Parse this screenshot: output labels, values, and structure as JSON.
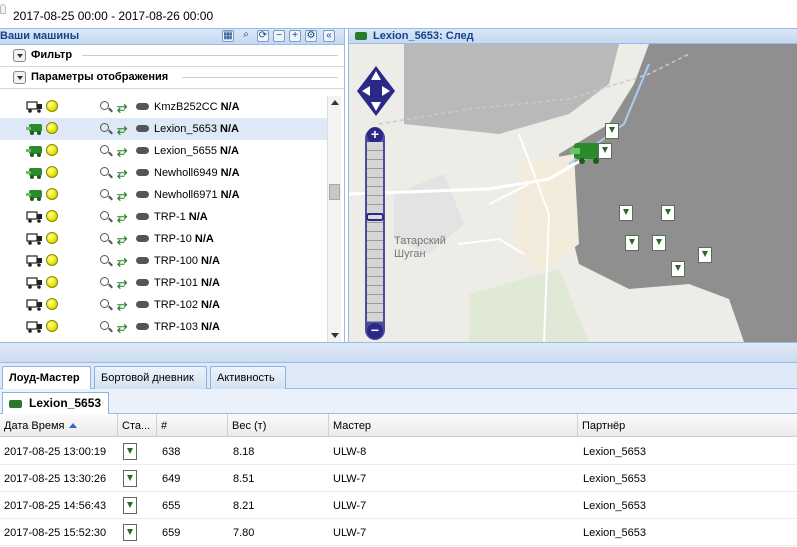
{
  "header": {
    "date_range": "2017-08-25 00:00 - 2017-08-26 00:00"
  },
  "left_panel": {
    "title": "Ваши машины",
    "filter_label": "Фильтр",
    "display_params_label": "Параметры отображения",
    "toolbar_icons": [
      "grid-icon",
      "search-icon",
      "refresh-icon",
      "minus-icon",
      "plus-icon",
      "settings-icon",
      "collapse-icon"
    ],
    "vehicles": [
      {
        "name": "KmzB252CC",
        "status": "N/A",
        "type": "truck",
        "selected": false
      },
      {
        "name": "Lexion_5653",
        "status": "N/A",
        "type": "harvester",
        "selected": true
      },
      {
        "name": "Lexion_5655",
        "status": "N/A",
        "type": "harvester",
        "selected": false
      },
      {
        "name": "Newholl6949",
        "status": "N/A",
        "type": "harvester",
        "selected": false
      },
      {
        "name": "Newholl6971",
        "status": "N/A",
        "type": "harvester",
        "selected": false
      },
      {
        "name": "TRP-1",
        "status": "N/A",
        "type": "truck",
        "selected": false
      },
      {
        "name": "TRP-10",
        "status": "N/A",
        "type": "truck",
        "selected": false
      },
      {
        "name": "TRP-100",
        "status": "N/A",
        "type": "truck",
        "selected": false
      },
      {
        "name": "TRP-101",
        "status": "N/A",
        "type": "truck",
        "selected": false
      },
      {
        "name": "TRP-102",
        "status": "N/A",
        "type": "truck",
        "selected": false
      },
      {
        "name": "TRP-103",
        "status": "N/A",
        "type": "truck",
        "selected": false
      }
    ]
  },
  "map_panel": {
    "title": "Lexion_5653: След",
    "town_label_line1": "Татарский",
    "town_label_line2": "Шуган",
    "zoom_in": "+",
    "zoom_out": "−"
  },
  "tabs": [
    {
      "label": "Лоуд-Мастер",
      "active": true
    },
    {
      "label": "Бортовой дневник",
      "active": false
    },
    {
      "label": "Активность",
      "active": false
    }
  ],
  "subtab": {
    "label": "Lexion_5653"
  },
  "grid": {
    "columns": [
      "Дата Время",
      "Ста...",
      "#",
      "Вес (т)",
      "Мастер",
      "Партнёр"
    ],
    "rows": [
      {
        "datetime": "2017-08-25 13:00:19",
        "num": "638",
        "weight": "8.18",
        "master": "ULW-8",
        "partner": "Lexion_5653"
      },
      {
        "datetime": "2017-08-25 13:30:26",
        "num": "649",
        "weight": "8.51",
        "master": "ULW-7",
        "partner": "Lexion_5653"
      },
      {
        "datetime": "2017-08-25 14:56:43",
        "num": "655",
        "weight": "8.21",
        "master": "ULW-7",
        "partner": "Lexion_5653"
      },
      {
        "datetime": "2017-08-25 15:52:30",
        "num": "659",
        "weight": "7.80",
        "master": "ULW-7",
        "partner": "Lexion_5653"
      }
    ]
  },
  "colors": {
    "accent": "#15428b",
    "selection": "#dfe8f6",
    "field_dark": "#8a8a8a",
    "status_yellow": "#e7e400"
  }
}
